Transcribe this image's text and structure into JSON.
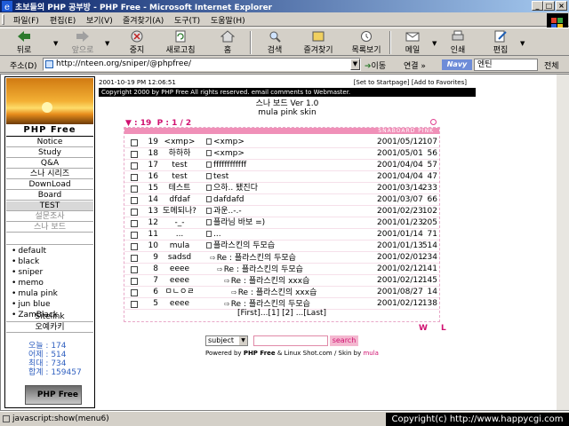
{
  "window": {
    "title": "초보들의 PHP 공부방 - PHP Free - Microsoft Internet Explorer"
  },
  "menu": {
    "items": [
      "파일(F)",
      "편집(E)",
      "보기(V)",
      "즐겨찾기(A)",
      "도구(T)",
      "도움말(H)"
    ]
  },
  "toolbar": {
    "back": "뒤로",
    "forward": "앞으로",
    "stop": "중지",
    "refresh": "새로고침",
    "home": "홈",
    "search": "검색",
    "favorites": "즐겨찾기",
    "history": "목록보기",
    "mail": "메일",
    "print": "인쇄",
    "edit": "편집"
  },
  "address": {
    "label": "주소(D)",
    "url": "http://nteen.org/sniper/@phpfree/",
    "go": "이동",
    "links": "연결 »",
    "navy_logo": "Navy",
    "navy_value": "엔틴",
    "navy_all": "전체"
  },
  "nav": {
    "title": "PHP Free",
    "items": [
      "Notice",
      "Study",
      "Q&A",
      "스나 시리즈",
      "DownLoad",
      "Board",
      "TEST",
      "설문조사",
      "스나 보드"
    ],
    "skins": [
      "default",
      "black",
      "sniper",
      "memo",
      "mula pink",
      "jun blue",
      "ZamBlack"
    ],
    "after": [
      "Sitelink",
      "오예카키"
    ],
    "stats": [
      "오늘 : 174",
      "어제 : 514",
      "최대 : 734",
      "합계 : 159457"
    ],
    "logo": "PHP Free"
  },
  "board": {
    "date_line": "2001-10-19 PM 12:06:51",
    "links": "[Set to Startpage] [Add to Favorites]",
    "copyright": "Copyright 2000 by PHP Free All rights reserved. email comments to Webmaster.",
    "title": "스나 보드 Ver 1.0",
    "skin": "mula pink skin",
    "total": "19",
    "page": "1 / 2",
    "header_text": "SNABOARD  PINK",
    "rows": [
      {
        "num": "19",
        "name": "<xmp>",
        "subject": "<xmp>",
        "date": "2001/05/12",
        "hit": "107"
      },
      {
        "num": "18",
        "name": "하하하",
        "subject": "<xmp>",
        "date": "2001/05/01",
        "hit": "56"
      },
      {
        "num": "17",
        "name": "test",
        "subject": "ffffffffffff",
        "date": "2001/04/04",
        "hit": "57"
      },
      {
        "num": "16",
        "name": "test",
        "subject": "test",
        "date": "2001/04/04",
        "hit": "47"
      },
      {
        "num": "15",
        "name": "테스트",
        "subject": "으하.. 됐진다",
        "date": "2001/03/14",
        "hit": "233"
      },
      {
        "num": "14",
        "name": "dfdaf",
        "subject": "dafdafd",
        "date": "2001/03/07",
        "hit": "66"
      },
      {
        "num": "13",
        "name": "도메되나?",
        "subject": "과운..-.-",
        "date": "2001/02/23",
        "hit": "102"
      },
      {
        "num": "12",
        "name": "-_-",
        "subject": "플라님 바보 =)",
        "date": "2001/01/23",
        "hit": "205"
      },
      {
        "num": "11",
        "name": "...",
        "subject": "...",
        "date": "2001/01/14",
        "hit": "71"
      },
      {
        "num": "10",
        "name": "mula",
        "subject": "플라스킨의 두모습",
        "date": "2001/01/13",
        "hit": "514"
      },
      {
        "num": "9",
        "name": "sadsd",
        "subject": "Re : 플라스킨의 두모습",
        "date": "2001/02/01",
        "hit": "234"
      },
      {
        "num": "8",
        "name": "eeee",
        "subject": "Re : 플라스킨의 두모습",
        "date": "2001/02/12",
        "hit": "141"
      },
      {
        "num": "7",
        "name": "eeee",
        "subject": "Re : 플라스킨의 xxx습",
        "date": "2001/02/12",
        "hit": "145"
      },
      {
        "num": "6",
        "name": "ㅁㄴㅇㄹ",
        "subject": "Re : 플라스킨의 xxx습",
        "date": "2001/08/27",
        "hit": "14"
      },
      {
        "num": "5",
        "name": "eeee",
        "subject": "Re : 플라스킨의 두모습",
        "date": "2001/02/12",
        "hit": "138"
      }
    ],
    "pager": "[First]...[1] [2] ...[Last]",
    "wl": "W L",
    "search_select": "subject",
    "search_button": "search",
    "powered_pre": "Powered by",
    "powered_brand": "PHP Free",
    "powered_mid": "& Linux Shot.com / Skin by",
    "powered_author": "mula"
  },
  "status": {
    "text": "javascript:show(menu6)",
    "copyright": "Copyright(c) http://www.happycgi.com"
  }
}
